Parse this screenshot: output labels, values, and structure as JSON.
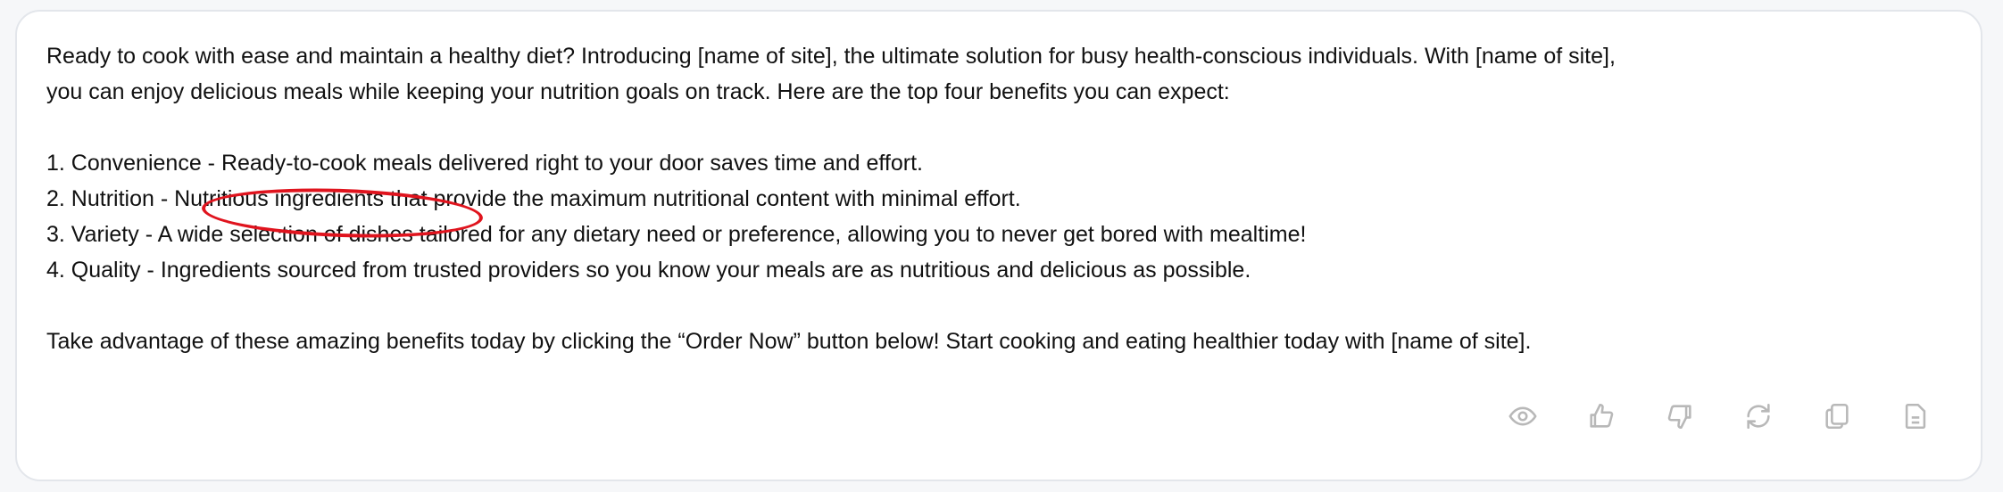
{
  "message": {
    "lines": [
      "Ready to cook with ease and maintain a healthy diet? Introducing [name of site], the ultimate solution for busy health-conscious individuals. With [name of site],",
      "you can enjoy delicious meals while keeping your nutrition goals on track. Here are the top four benefits you can expect:",
      "1. Convenience - Ready-to-cook meals delivered right to your door saves time and effort.",
      "2. Nutrition - Nutritious ingredients that provide the maximum nutritional content with minimal effort.",
      "3. Variety - A wide selection of dishes tailored for any dietary need or preference, allowing you to never get bored with mealtime!",
      "4. Quality - Ingredients sourced from trusted providers so you know your meals are as nutritious and delicious as possible.",
      "Take advantage of these amazing benefits today by clicking the “Order Now” button below! Start cooking and eating healthier today with [name of site]."
    ]
  },
  "annotation": {
    "color": "#e0141e",
    "target": "Nutritious ingredients"
  },
  "actions": [
    "eye-icon",
    "thumbs-up-icon",
    "thumbs-down-icon",
    "regenerate-icon",
    "copy-icon",
    "document-icon"
  ],
  "colors": {
    "icon": "#b8b8b8",
    "border": "#e3e6eb",
    "background": "#f6f7f9"
  }
}
